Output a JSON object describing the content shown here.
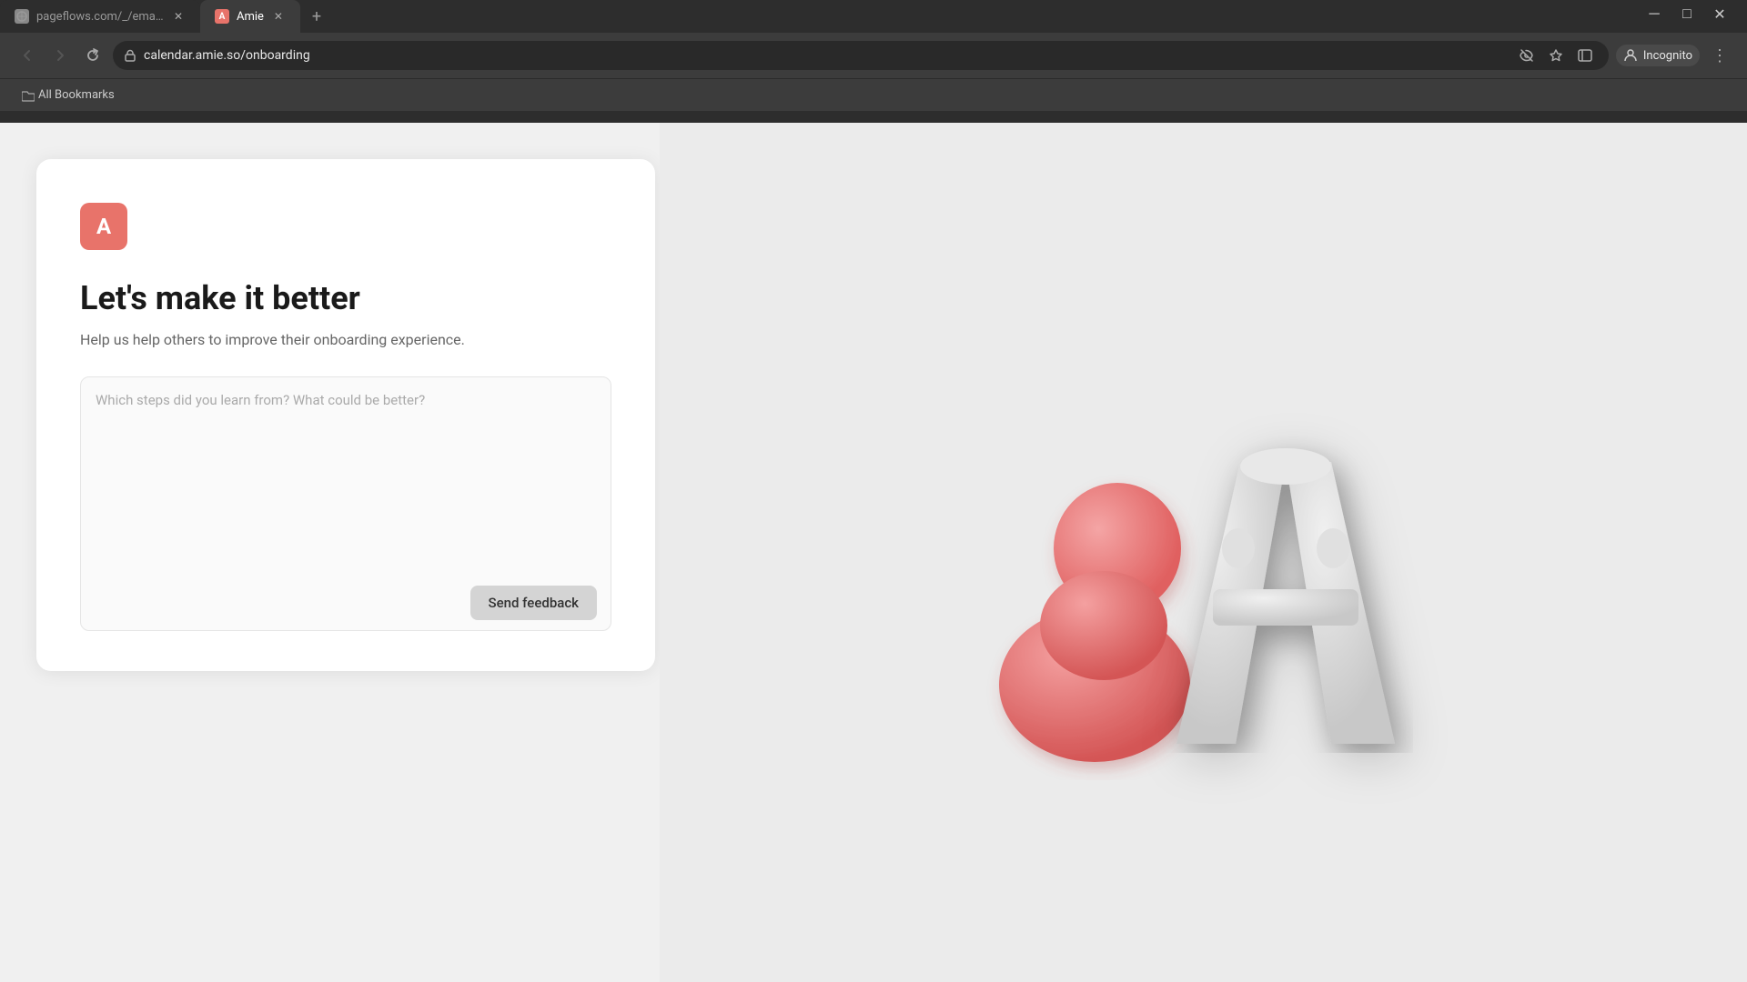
{
  "browser": {
    "tabs": [
      {
        "id": "tab-1",
        "label": "pageflows.com/_/emails/_/7fb...",
        "favicon": "globe",
        "active": false
      },
      {
        "id": "tab-2",
        "label": "Amie",
        "favicon": "A",
        "active": true
      }
    ],
    "address": "calendar.amie.so/onboarding",
    "profile": "Incognito",
    "bookmarks_label": "All Bookmarks"
  },
  "page": {
    "logo_letter": "A",
    "title": "Let's make it better",
    "subtitle": "Help us help others to improve their onboarding experience.",
    "textarea_placeholder": "Which steps did you learn from? What could be better?",
    "send_button_label": "Send feedback"
  },
  "icons": {
    "back": "←",
    "forward": "→",
    "refresh": "↻",
    "lock": "🔒",
    "star": "☆",
    "sidebar": "▤",
    "more": "⋮",
    "close": "✕",
    "new_tab": "+",
    "minimize": "─",
    "maximize": "□",
    "close_window": "✕",
    "eye_slash": "👁",
    "folder": "📁"
  }
}
